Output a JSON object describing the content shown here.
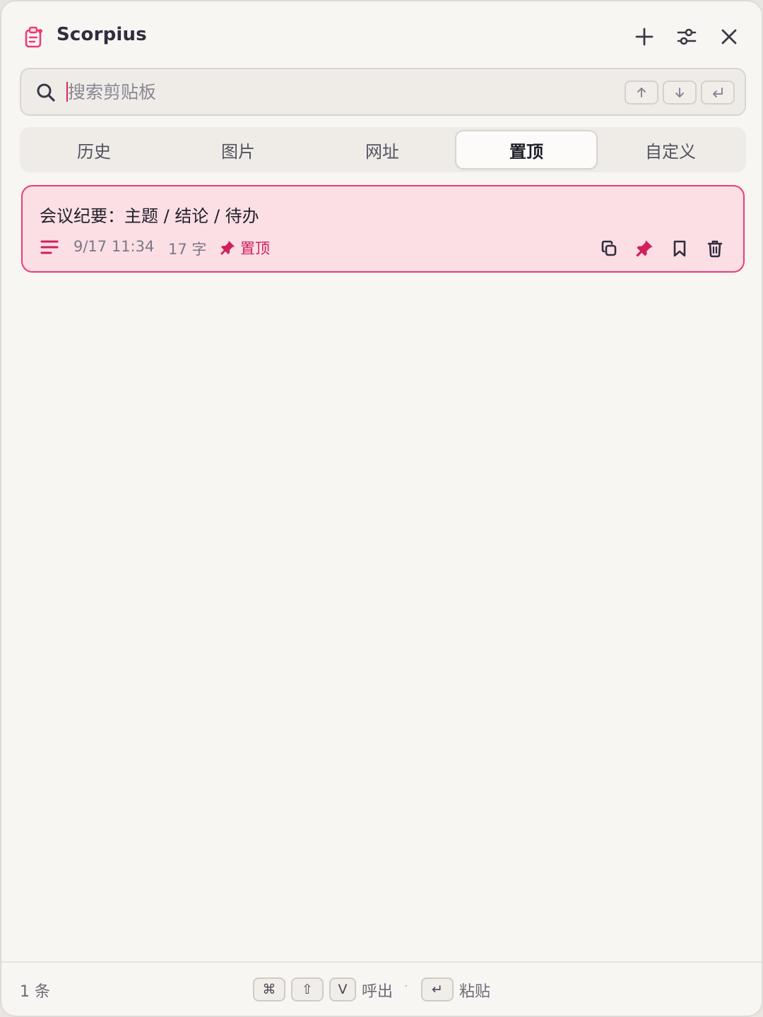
{
  "app": {
    "title": "Scorpius",
    "accent": "#e0245e"
  },
  "titlebar": {
    "icons": [
      "clipboard-icon",
      "plus-icon",
      "sliders-icon",
      "close-icon"
    ]
  },
  "search": {
    "placeholder": "搜索剪贴板",
    "value": "",
    "keys": [
      "arrow-up",
      "arrow-down",
      "enter"
    ]
  },
  "tabs": [
    {
      "label": "历史",
      "active": false
    },
    {
      "label": "图片",
      "active": false
    },
    {
      "label": "网址",
      "active": false
    },
    {
      "label": "置顶",
      "active": true
    },
    {
      "label": "自定义",
      "active": false
    }
  ],
  "clips": [
    {
      "text": "会议纪要：主题 / 结论 / 待办",
      "time": "9/17 11:34",
      "count": "17 字",
      "pin_label": "置顶",
      "pinned": true,
      "selected": true
    }
  ],
  "footer": {
    "count": "1 条",
    "shortcut_keys": [
      "⌘",
      "⇧",
      "V"
    ],
    "call_label": "呼出",
    "separator": "·",
    "enter_key": "↵",
    "paste_label": "粘贴"
  }
}
